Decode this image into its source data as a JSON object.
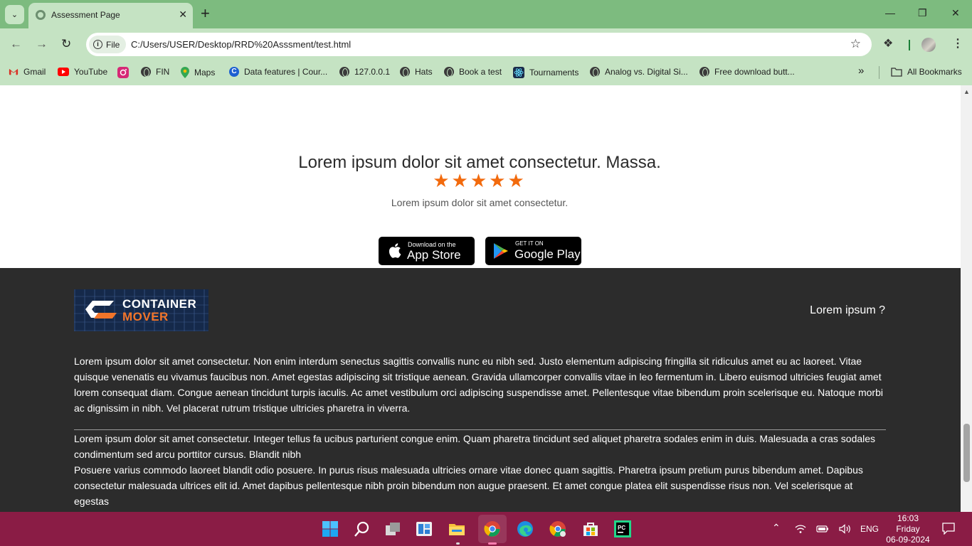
{
  "browser": {
    "tab_title": "Assessment Page",
    "new_tab": "+",
    "url_chip": "File",
    "url": "C:/Users/USER/Desktop/RRD%20Asssment/test.html",
    "bookmarks": [
      {
        "label": "Gmail",
        "icon": "gmail-icon"
      },
      {
        "label": "YouTube",
        "icon": "youtube-icon"
      },
      {
        "label": "",
        "icon": "instagram-icon"
      },
      {
        "label": "FIN",
        "icon": "globe-icon"
      },
      {
        "label": "Maps",
        "icon": "maps-icon"
      },
      {
        "label": "Data features | Cour...",
        "icon": "coursera-icon"
      },
      {
        "label": "127.0.0.1",
        "icon": "globe-icon"
      },
      {
        "label": "Hats",
        "icon": "globe-icon"
      },
      {
        "label": "Book a test",
        "icon": "globe-icon"
      },
      {
        "label": "Tournaments",
        "icon": "react-icon"
      },
      {
        "label": "Analog vs. Digital Si...",
        "icon": "globe-icon"
      },
      {
        "label": "Free download butt...",
        "icon": "globe-icon"
      }
    ],
    "overflow": "»",
    "all_bookmarks": "All Bookmarks"
  },
  "hero": {
    "title": "Lorem ipsum dolor sit amet consectetur. Massa.",
    "rating": 5,
    "rating_max": 5,
    "star_color": "#f26a0d",
    "subtitle": "Lorem ipsum dolor sit amet consectetur."
  },
  "store_buttons": {
    "app_store_small": "Download on the",
    "app_store_big": "App Store",
    "google_play_small": "GET IT ON",
    "google_play_big": "Google Play"
  },
  "footer": {
    "logo_line1": "CONTAINER",
    "logo_line2": "MOVER",
    "logo_accent": "#f2752a",
    "question": "Lorem ipsum ?",
    "paragraph1": "Lorem ipsum dolor sit amet consectetur. Non enim interdum senectus sagittis convallis nunc eu nibh sed. Justo elementum adipiscing fringilla sit ridiculus amet eu ac laoreet. Vitae quisque venenatis eu vivamus faucibus non. Amet egestas adipiscing sit tristique aenean. Gravida ullamcorper convallis vitae in leo fermentum in. Libero euismod ultricies feugiat amet lorem consequat diam. Congue aenean tincidunt turpis iaculis. Ac amet vestibulum orci adipiscing suspendisse amet. Pellentesque vitae bibendum proin scelerisque eu. Natoque morbi ac dignissim in nibh. Vel placerat rutrum tristique ultricies pharetra in viverra.",
    "paragraph2": "Lorem ipsum dolor sit amet consectetur. Integer tellus fa ucibus parturient congue enim. Quam pharetra tincidunt sed aliquet pharetra sodales enim in duis. Malesuada a cras sodales condimentum sed arcu porttitor cursus. Blandit nibh",
    "paragraph3": "Posuere varius commodo laoreet blandit odio posuere. In purus risus malesuada ultricies ornare vitae donec quam sagittis. Pharetra ipsum pretium purus bibendum amet. Dapibus consectetur malesuada ultrices elit id. Amet dapibus pellentesque nibh proin bibendum non augue praesent. Et amet congue platea elit suspendisse risus non. Vel scelerisque at egestas"
  },
  "taskbar": {
    "language": "ENG",
    "time": "16:03",
    "day": "Friday",
    "date": "06-09-2024"
  }
}
